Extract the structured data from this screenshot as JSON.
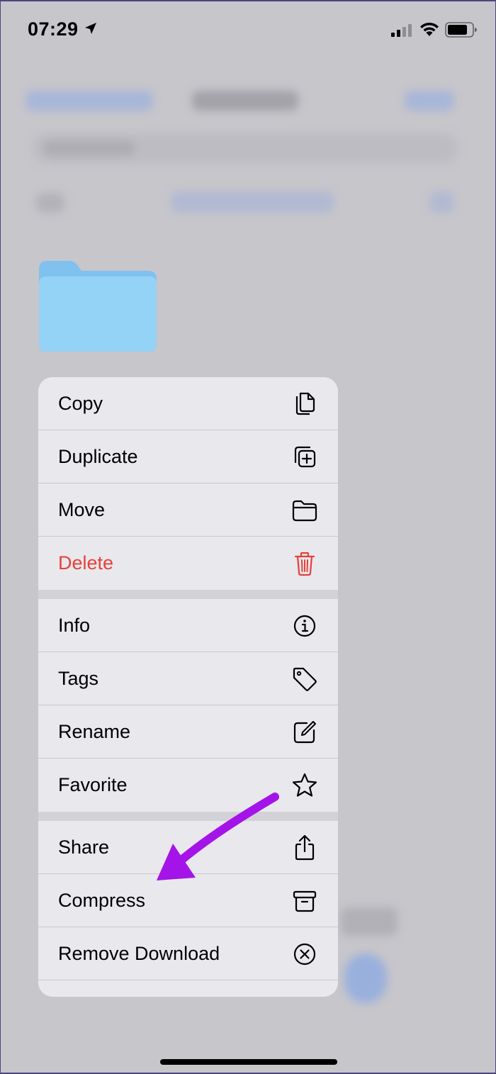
{
  "status_bar": {
    "time": "07:29"
  },
  "icons": {
    "location": "location-arrow-icon",
    "signal": "cellular-signal-icon",
    "wifi": "wifi-icon",
    "battery": "battery-icon",
    "folder": "folder-icon"
  },
  "colors": {
    "destructive": "#e5413b",
    "folder": "#8fcdf5",
    "annotation_arrow": "#a414e8"
  },
  "menu": {
    "items": [
      {
        "label": "Copy",
        "icon": "copy-icon"
      },
      {
        "label": "Duplicate",
        "icon": "duplicate-icon"
      },
      {
        "label": "Move",
        "icon": "folder-icon"
      },
      {
        "label": "Delete",
        "icon": "trash-icon",
        "destructive": true
      },
      {
        "label": "Info",
        "icon": "info-icon"
      },
      {
        "label": "Tags",
        "icon": "tag-icon"
      },
      {
        "label": "Rename",
        "icon": "pencil-square-icon"
      },
      {
        "label": "Favorite",
        "icon": "star-icon"
      },
      {
        "label": "Share",
        "icon": "share-icon"
      },
      {
        "label": "Compress",
        "icon": "archive-box-icon"
      },
      {
        "label": "Remove Download",
        "icon": "x-circle-icon"
      }
    ]
  }
}
